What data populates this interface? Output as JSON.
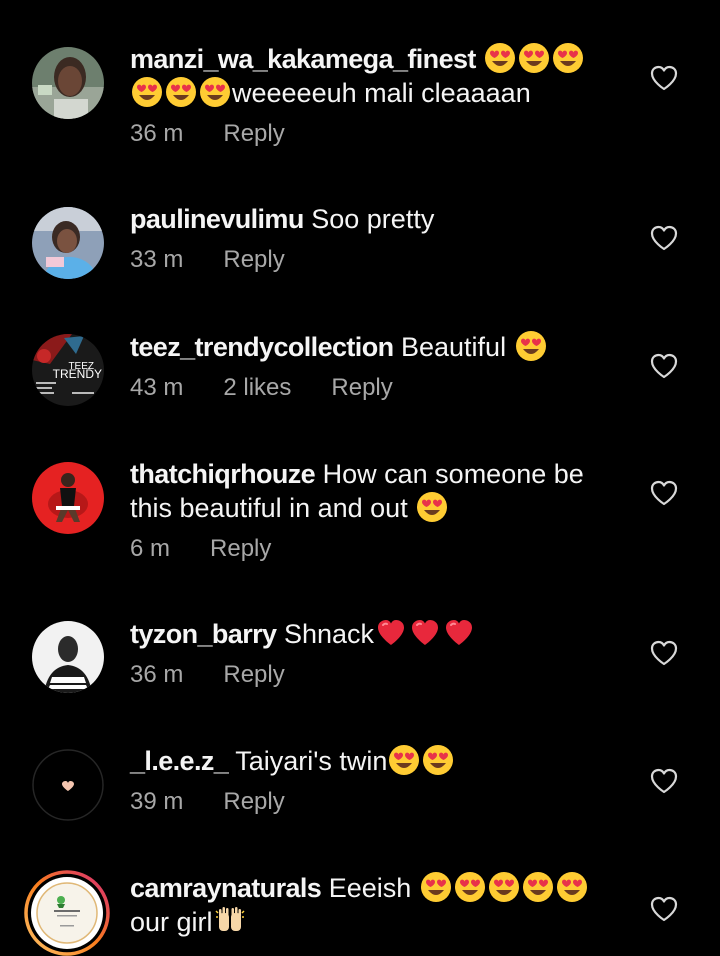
{
  "comments": [
    {
      "username": "manzi_wa_kakamega_finest",
      "text": "weeeeeuh mali cleaaaan",
      "time": "36 m",
      "likes": "",
      "reply_label": "Reply",
      "avatar_icon": "profile-photo-woman"
    },
    {
      "username": "paulinevulimu",
      "text": "Soo pretty",
      "time": "33 m",
      "likes": "",
      "reply_label": "Reply",
      "avatar_icon": "profile-photo-girl"
    },
    {
      "username": "teez_trendycollection",
      "text": "Beautiful",
      "time": "43 m",
      "likes": "2 likes",
      "reply_label": "Reply",
      "avatar_icon": "teez-trendy-logo",
      "avatar_text_1": "TEEZ",
      "avatar_text_2": "TRENDY"
    },
    {
      "username": "thatchiqrhouze",
      "text": "How can someone be this beautiful in and out",
      "time": "6 m",
      "likes": "",
      "reply_label": "Reply",
      "avatar_icon": "profile-photo-woman-red-background"
    },
    {
      "username": "tyzon_barry",
      "text": "Shnack",
      "time": "36 m",
      "likes": "",
      "reply_label": "Reply",
      "avatar_icon": "profile-photo-man"
    },
    {
      "username": "_l.e.e.z_",
      "text": "Taiyari's twin",
      "time": "39 m",
      "likes": "",
      "reply_label": "Reply",
      "avatar_icon": "small-heart-avatar"
    },
    {
      "username": "camraynaturals",
      "text_1": "Eeeish",
      "text_2": "our girl",
      "avatar_icon": "camray-naturals-logo"
    }
  ],
  "colors": {
    "background": "#000000",
    "text": "#f5f5f5",
    "meta": "#a8a8a8",
    "story_ring_start": "#fdc468",
    "story_ring_end": "#d62976"
  }
}
